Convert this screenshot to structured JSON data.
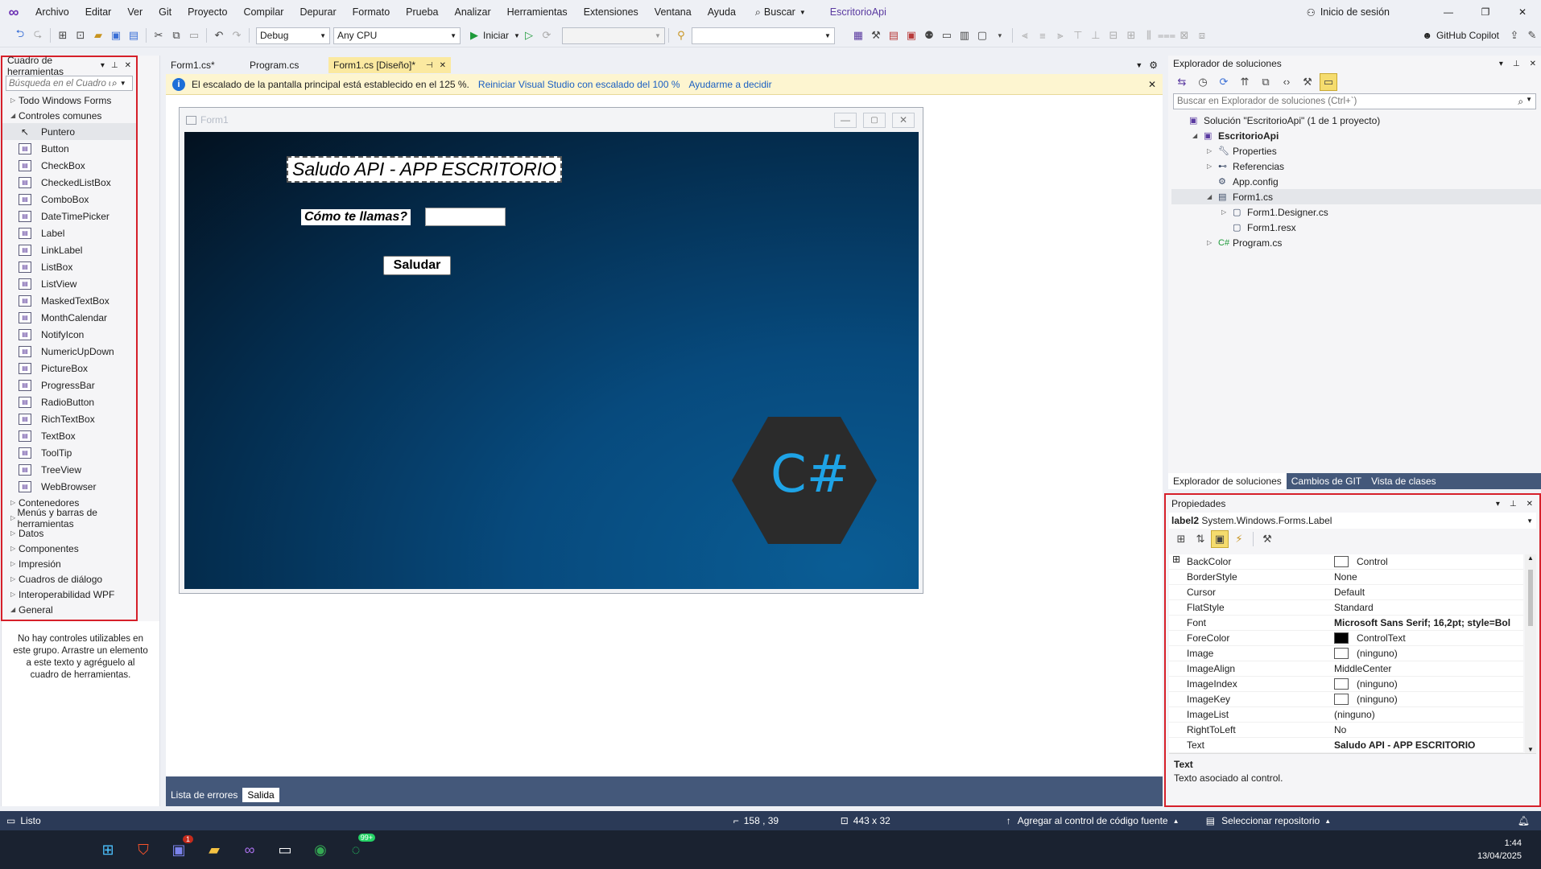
{
  "menu": [
    "Archivo",
    "Editar",
    "Ver",
    "Git",
    "Proyecto",
    "Compilar",
    "Depurar",
    "Formato",
    "Prueba",
    "Analizar",
    "Herramientas",
    "Extensiones",
    "Ventana",
    "Ayuda"
  ],
  "search_label": "Buscar",
  "app_title": "EscritorioApi",
  "signin_label": "Inicio de sesión",
  "copilot_label": "GitHub Copilot",
  "toolbar": {
    "config": "Debug",
    "platform": "Any CPU",
    "run_label": "Iniciar"
  },
  "toolbox": {
    "title": "Cuadro de herramientas",
    "search_placeholder": "Búsqueda en el Cuadro de he",
    "all_forms": "Todo Windows Forms",
    "common": "Controles comunes",
    "items": [
      "Puntero",
      "Button",
      "CheckBox",
      "CheckedListBox",
      "ComboBox",
      "DateTimePicker",
      "Label",
      "LinkLabel",
      "ListBox",
      "ListView",
      "MaskedTextBox",
      "MonthCalendar",
      "NotifyIcon",
      "NumericUpDown",
      "PictureBox",
      "ProgressBar",
      "RadioButton",
      "RichTextBox",
      "TextBox",
      "ToolTip",
      "TreeView",
      "WebBrowser"
    ],
    "categories": [
      "Contenedores",
      "Menús y barras de herramientas",
      "Datos",
      "Componentes",
      "Impresión",
      "Cuadros de diálogo",
      "Interoperabilidad WPF"
    ],
    "general": "General",
    "empty_message": "No hay controles utilizables en este grupo. Arrastre un elemento a este texto y agréguelo al cuadro de herramientas."
  },
  "tabs": [
    "Form1.cs*",
    "Program.cs",
    "Form1.cs [Diseño]*"
  ],
  "infobar": {
    "message": "El escalado de la pantalla principal está establecido en el 125 %.",
    "link1": "Reiniciar Visual Studio con escalado del 100 %",
    "link2": "Ayudarme a decidir"
  },
  "designer": {
    "form_title": "Form1",
    "heading": "Saludo API - APP ESCRITORIO",
    "prompt": "Cómo te llamas?",
    "button": "Saludar",
    "logo_text": "C#"
  },
  "output_tabs": [
    "Lista de errores",
    "Salida"
  ],
  "output_title": "Salida",
  "solution": {
    "title": "Explorador de soluciones",
    "search_placeholder": "Buscar en Explorador de soluciones (Ctrl+`)",
    "nodes": [
      {
        "label": "Solución \"EscritorioApi\" (1 de 1 proyecto)",
        "indent": 0
      },
      {
        "label": "EscritorioApi",
        "indent": 1
      },
      {
        "label": "Properties",
        "indent": 2
      },
      {
        "label": "Referencias",
        "indent": 2
      },
      {
        "label": "App.config",
        "indent": 2
      },
      {
        "label": "Form1.cs",
        "indent": 2
      },
      {
        "label": "Form1.Designer.cs",
        "indent": 3
      },
      {
        "label": "Form1.resx",
        "indent": 3
      },
      {
        "label": "Program.cs",
        "indent": 2
      }
    ],
    "tabs": [
      "Explorador de soluciones",
      "Cambios de GIT",
      "Vista de clases"
    ]
  },
  "properties": {
    "title": "Propiedades",
    "object": "label2",
    "object_type": "System.Windows.Forms.Label",
    "rows": [
      {
        "name": "BackColor",
        "value": "Control",
        "swatch": "#ffffff"
      },
      {
        "name": "BorderStyle",
        "value": "None"
      },
      {
        "name": "Cursor",
        "value": "Default"
      },
      {
        "name": "FlatStyle",
        "value": "Standard"
      },
      {
        "name": "Font",
        "value": "Microsoft Sans Serif; 16,2pt; style=Bol",
        "bold": true,
        "expand": true
      },
      {
        "name": "ForeColor",
        "value": "ControlText",
        "swatch": "#000000"
      },
      {
        "name": "Image",
        "value": "(ninguno)",
        "swatch": "#ffffff"
      },
      {
        "name": "ImageAlign",
        "value": "MiddleCenter"
      },
      {
        "name": "ImageIndex",
        "value": "(ninguno)",
        "swatch": "#ffffff"
      },
      {
        "name": "ImageKey",
        "value": "(ninguno)",
        "swatch": "#ffffff"
      },
      {
        "name": "ImageList",
        "value": "(ninguno)"
      },
      {
        "name": "RightToLeft",
        "value": "No"
      },
      {
        "name": "Text",
        "value": "Saludo API - APP ESCRITORIO",
        "bold": true
      }
    ],
    "desc_title": "Text",
    "desc_text": "Texto asociado al control."
  },
  "status": {
    "ready": "Listo",
    "position": "158 , 39",
    "size": "443 x 32",
    "source_control": "Agregar al control de código fuente",
    "repo": "Seleccionar repositorio"
  },
  "taskbar": {
    "time": "1:44",
    "date": "13/04/2025",
    "teams_badge": "1",
    "whatsapp_badge": "99+"
  },
  "colors": {
    "accent": "#6b2fb3",
    "statusbar": "#2b3a57",
    "redbox": "#d6202a",
    "form_bg_start": "#03111f",
    "form_bg_end": "#0a5d95"
  }
}
